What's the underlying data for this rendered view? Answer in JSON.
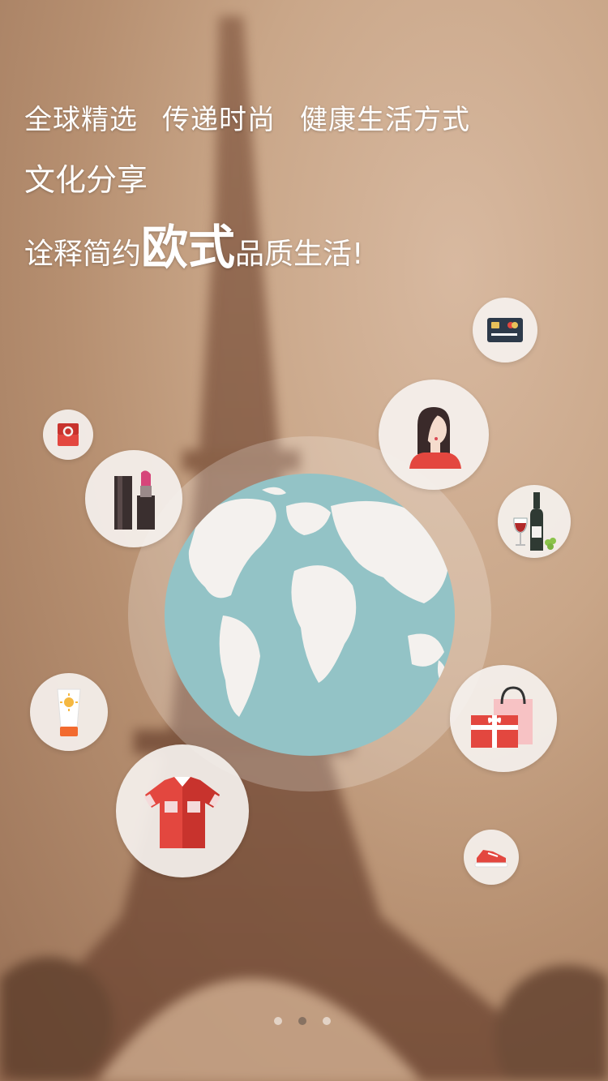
{
  "headline": {
    "line1": [
      "全球精选",
      "传递时尚",
      "健康生活方式"
    ],
    "line2": "文化分享",
    "line3_pre": "诠释简约",
    "line3_emphasis": "欧式",
    "line3_post": "品质生活!"
  },
  "icons": [
    "credit-card-icon",
    "woman-portrait-icon",
    "ring-box-icon",
    "lipstick-icon",
    "wine-bottle-icon",
    "globe-icon",
    "shopping-gift-icon",
    "sunscreen-icon",
    "polo-shirt-icon",
    "sneaker-icon"
  ],
  "pagination": {
    "count": 3,
    "active_index": 1
  },
  "colors": {
    "globe_ocean": "#93c3c6",
    "land": "#f4f1ee",
    "accent_red": "#e3473f"
  }
}
